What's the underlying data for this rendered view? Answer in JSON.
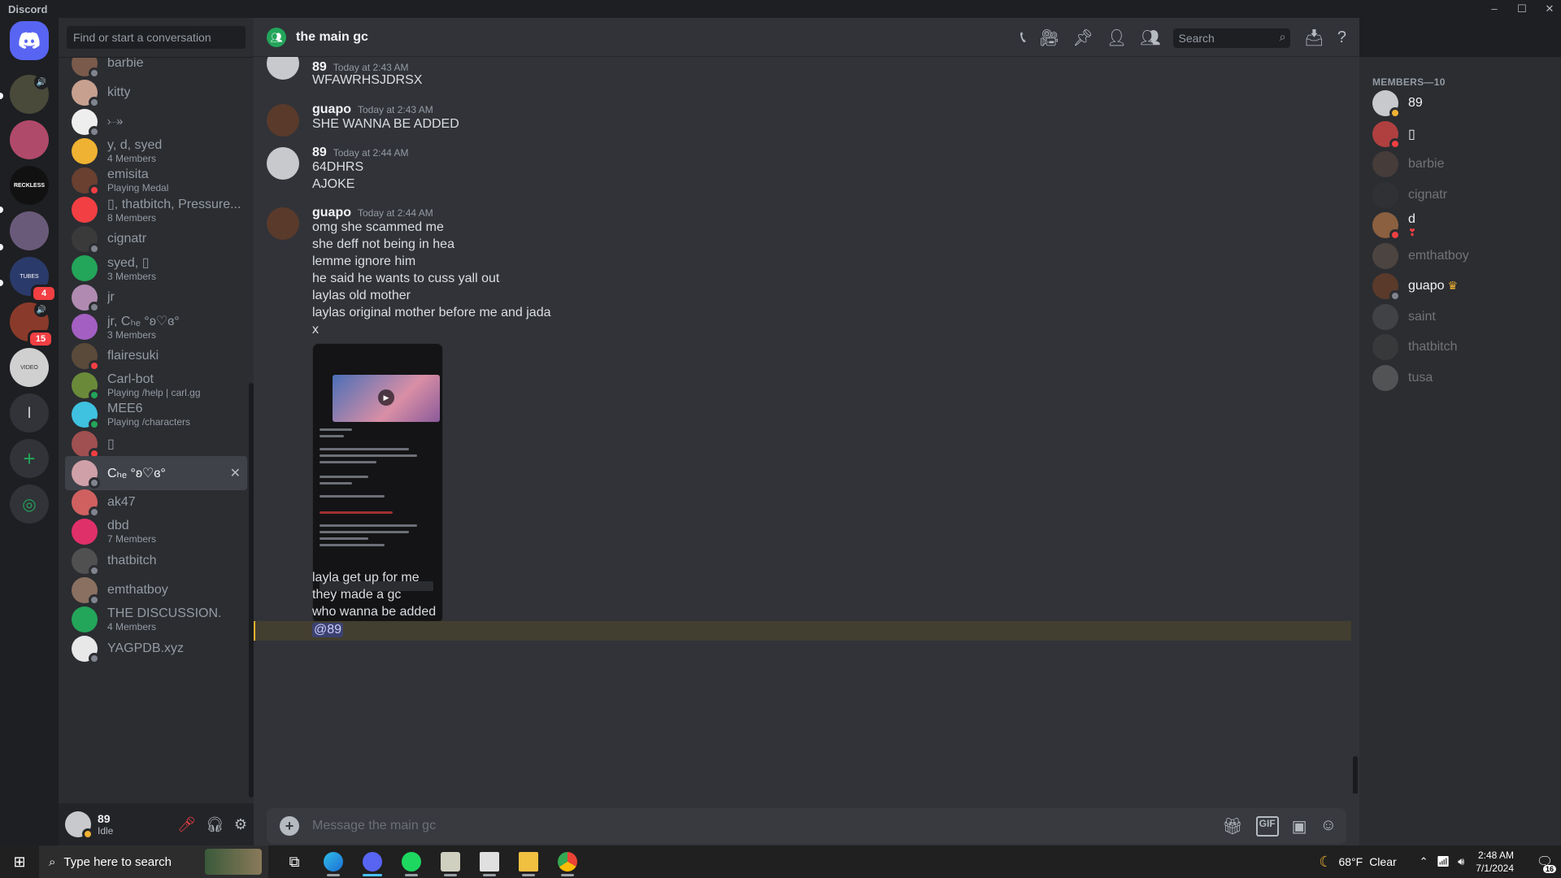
{
  "window": {
    "app_title": "Discord"
  },
  "rail": {
    "badges": [
      "4",
      "15"
    ],
    "letter_server": "l"
  },
  "dm_sidebar": {
    "search_placeholder": "Find or start a conversation",
    "items": [
      {
        "name": "barbie",
        "sub": "",
        "color": "#7a5a4a",
        "status": "#80848e"
      },
      {
        "name": "kitty",
        "sub": "",
        "color": "#c8a090",
        "status": "#80848e"
      },
      {
        "name": "⤐",
        "sub": "",
        "color": "#eeeeee",
        "status": "#80848e"
      },
      {
        "name": "y, d, syed",
        "sub": "4 Members",
        "color": "#f0b232",
        "status": ""
      },
      {
        "name": "emisita",
        "sub": "Playing Medal",
        "color": "#6a4030",
        "status": "#f23f43"
      },
      {
        "name": "▯, thatbitch, Pressure...",
        "sub": "8 Members",
        "color": "#f23f43",
        "status": ""
      },
      {
        "name": "cignatr",
        "sub": "",
        "color": "#3a3a3a",
        "status": "#80848e"
      },
      {
        "name": "syed, ▯",
        "sub": "3 Members",
        "color": "#23a55a",
        "status": ""
      },
      {
        "name": "jr",
        "sub": "",
        "color": "#b08ab0",
        "status": "#80848e"
      },
      {
        "name": "jr, Cₕₑ °ʚ♡ɞ°",
        "sub": "3 Members",
        "color": "#a35fc2",
        "status": ""
      },
      {
        "name": "flairesuki",
        "sub": "",
        "color": "#5a4a3a",
        "status": "#f23f43"
      },
      {
        "name": "Carl-bot",
        "sub": "Playing /help | carl.gg",
        "color": "#6a8a3a",
        "status": "#23a55a"
      },
      {
        "name": "MEE6",
        "sub": "Playing /characters",
        "color": "#3fc1e0",
        "status": "#23a55a"
      },
      {
        "name": "▯",
        "sub": "",
        "color": "#a05050",
        "status": "#f23f43"
      },
      {
        "name": "Cₕₑ °ʚ♡ɞ°",
        "sub": "",
        "color": "#d0a0a8",
        "status": "#80848e"
      },
      {
        "name": "ak47",
        "sub": "",
        "color": "#d06060",
        "status": "#80848e"
      },
      {
        "name": "dbd",
        "sub": "7 Members",
        "color": "#e0306a",
        "status": ""
      },
      {
        "name": "thatbitch",
        "sub": "",
        "color": "#505050",
        "status": "#80848e"
      },
      {
        "name": "emthatboy",
        "sub": "",
        "color": "#8a7060",
        "status": "#80848e"
      },
      {
        "name": "THE DISCUSSION.",
        "sub": "4 Members",
        "color": "#23a55a",
        "status": ""
      },
      {
        "name": "YAGPDB.xyz",
        "sub": "",
        "color": "#e8e8e8",
        "status": "#80848e"
      }
    ]
  },
  "user_panel": {
    "name": "89",
    "status": "Idle"
  },
  "channel": {
    "title": "the main gc",
    "search_placeholder": "Search",
    "composer_placeholder": "Message the main gc"
  },
  "messages": [
    {
      "author": "89",
      "time": "Today at 2:43 AM",
      "lines": [
        "WFAWRHSJDRSX"
      ]
    },
    {
      "author": "guapo",
      "time": "Today at 2:43 AM",
      "lines": [
        "SHE WANNA BE ADDED"
      ]
    },
    {
      "author": "89",
      "time": "Today at 2:44 AM",
      "lines": [
        "64DHRS",
        "AJOKE"
      ]
    },
    {
      "author": "guapo",
      "time": "Today at 2:44 AM",
      "lines": [
        "omg she scammed me",
        "she deff not being in hea",
        "lemme ignore him",
        "he said he wants to cuss yall out",
        "laylas old mother",
        "laylas original mother before me and jada",
        "x"
      ]
    }
  ],
  "after_attachment_lines": [
    "layla get up for me",
    "they made a gc",
    "who wanna be added"
  ],
  "mention": "@89",
  "members": {
    "header": "MEMBERS—10",
    "list": [
      {
        "name": "89",
        "activity": "",
        "online": true,
        "color": "#c7c9cc",
        "status": "#f0b232",
        "owner": false
      },
      {
        "name": "▯",
        "activity": "",
        "online": true,
        "color": "#b04040",
        "status": "#f23f43",
        "owner": false
      },
      {
        "name": "barbie",
        "activity": "",
        "online": false,
        "color": "#7a5a4a",
        "status": "",
        "owner": false
      },
      {
        "name": "cignatr",
        "activity": "",
        "online": false,
        "color": "#3a3a3a",
        "status": "",
        "owner": false
      },
      {
        "name": "d",
        "activity": "❣",
        "online": true,
        "color": "#8a6040",
        "status": "#f23f43",
        "owner": false
      },
      {
        "name": "emthatboy",
        "activity": "",
        "online": false,
        "color": "#8a7060",
        "status": "",
        "owner": false
      },
      {
        "name": "guapo",
        "activity": "",
        "online": true,
        "color": "#5a3a2a",
        "status": "#80848e",
        "owner": true
      },
      {
        "name": "saint",
        "activity": "",
        "online": false,
        "color": "#6a6a6a",
        "status": "",
        "owner": false
      },
      {
        "name": "thatbitch",
        "activity": "",
        "online": false,
        "color": "#505050",
        "status": "",
        "owner": false
      },
      {
        "name": "tusa",
        "activity": "",
        "online": false,
        "color": "#9a9a9a",
        "status": "",
        "owner": false
      }
    ]
  },
  "taskbar": {
    "search_placeholder": "Type here to search",
    "temp": "68°F",
    "weather": "Clear",
    "time": "2:48 AM",
    "date": "7/1/2024",
    "notifications": "16"
  }
}
